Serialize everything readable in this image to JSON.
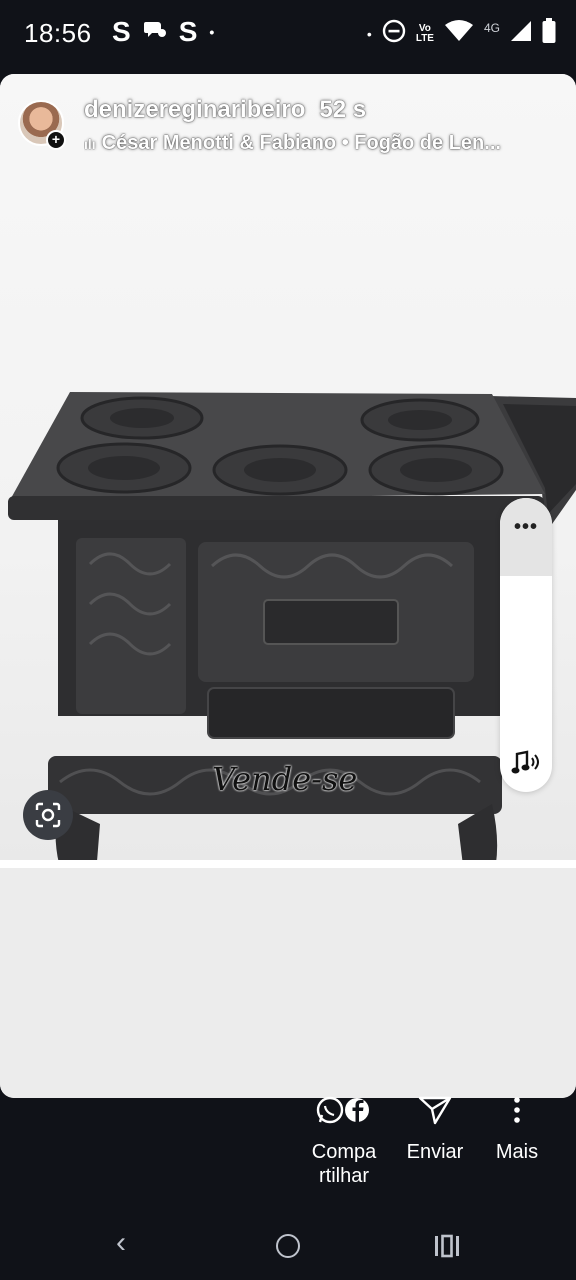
{
  "status_bar": {
    "time": "18:56",
    "left_icons": [
      "S",
      "chat-bubble-icon",
      "S",
      "•"
    ],
    "network": "4G",
    "volte_top": "Vo",
    "volte_bottom": "LTE"
  },
  "story": {
    "username": "denizereginaribeiro",
    "elapsed": "52 s",
    "music": "César Menotti & Fabiano • Fogão de Len...",
    "sticker_text": "Vende-se",
    "side_more": "•••",
    "side_music_icon": "♪"
  },
  "actions": {
    "share_label": "Compa\nrtilhar",
    "send_label": "Enviar",
    "more_label": "Mais"
  },
  "nav": {
    "back": "‹"
  },
  "colors": {
    "background": "#101218",
    "card": "#f1f1f1",
    "stove": "#3a3a3c"
  }
}
